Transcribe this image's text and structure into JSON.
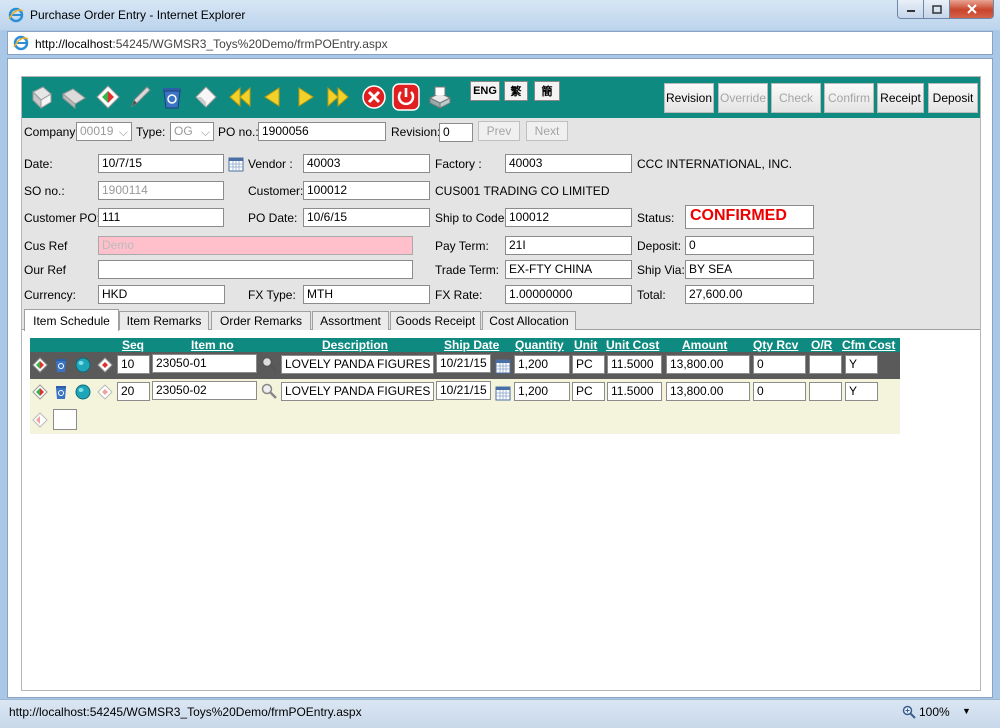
{
  "window": {
    "title": "Purchase Order Entry - Internet Explorer",
    "address_host": "http://localhost",
    "address_path": ":54245/WGMSR3_Toys%20Demo/frmPOEntry.aspx",
    "status_url": "http://localhost:54245/WGMSR3_Toys%20Demo/frmPOEntry.aspx",
    "zoom": "100%"
  },
  "toolbar": {
    "icons": [
      "new-icon",
      "copy-icon",
      "edit-diamond-icon",
      "pencil-icon",
      "recycle-bin-icon",
      "eraser-icon",
      "first-icon",
      "previous-icon",
      "next-icon",
      "last-icon",
      "cancel-icon",
      "power-icon",
      "print-icon"
    ],
    "lang_eng": "ENG",
    "lang_trad": "繁",
    "lang_simp": "簡",
    "revision": "Revision",
    "override": "Override",
    "check": "Check",
    "confirm": "Confirm",
    "receipt": "Receipt",
    "deposit": "Deposit"
  },
  "header": {
    "company_label": "Company",
    "company_value": "00019",
    "type_label": "Type:",
    "type_value": "OG",
    "po_label": "PO no.:",
    "po_value": "1900056",
    "revision_label": "Revision:",
    "revision_value": "0",
    "prev": "Prev",
    "next": "Next"
  },
  "form": {
    "date_label": "Date:",
    "date_value": "10/7/15",
    "vendor_label": "Vendor :",
    "vendor_value": "40003",
    "factory_label": "Factory :",
    "factory_value": "40003",
    "factory_name": "CCC INTERNATIONAL, INC.",
    "so_label": "SO no.:",
    "so_value": "1900114",
    "customer_label": "Customer:",
    "customer_value": "100012",
    "customer_name": "CUS001 TRADING CO LIMITED",
    "custpo_label": "Customer PO:",
    "custpo_value": "111",
    "podate_label": "PO Date:",
    "podate_value": "10/6/15",
    "shipto_label": "Ship to Code:",
    "shipto_value": "100012",
    "status_label": "Status:",
    "status_value": "CONFIRMED",
    "cusref_label": "Cus Ref",
    "cusref_value": "Demo",
    "payterm_label": "Pay Term:",
    "payterm_value": "21I",
    "deposit_label": "Deposit:",
    "deposit_value": "0",
    "ourref_label": "Our Ref",
    "ourref_value": "",
    "tradeterm_label": "Trade Term:",
    "tradeterm_value": "EX-FTY CHINA",
    "shipvia_label": "Ship Via:",
    "shipvia_value": "BY SEA",
    "currency_label": "Currency:",
    "currency_value": "HKD",
    "fxtype_label": "FX Type:",
    "fxtype_value": "MTH",
    "fxrate_label": "FX Rate:",
    "fxrate_value": "1.00000000",
    "total_label": "Total:",
    "total_value": "27,600.00"
  },
  "tabs": [
    "Item Schedule",
    "Item Remarks",
    "Order Remarks",
    "Assortment",
    "Goods Receipt",
    "Cost Allocation"
  ],
  "grid": {
    "columns": [
      "Seq",
      "Item no",
      "Description",
      "Ship Date",
      "Quantity",
      "Unit",
      "Unit Cost",
      "Amount",
      "Qty Rcv",
      "O/R",
      "Cfm Cost"
    ],
    "rows": [
      {
        "seq": "10",
        "item": "23050-01",
        "desc": "LOVELY PANDA FIGURES M",
        "ship": "10/21/15",
        "qty": "1,200",
        "unit": "PC",
        "cost": "11.5000",
        "amount": "13,800.00",
        "rcv": "0",
        "or": "",
        "cfm": "Y"
      },
      {
        "seq": "20",
        "item": "23050-02",
        "desc": "LOVELY PANDA FIGURES M",
        "ship": "10/21/15",
        "qty": "1,200",
        "unit": "PC",
        "cost": "11.5000",
        "amount": "13,800.00",
        "rcv": "0",
        "or": "",
        "cfm": "Y"
      }
    ],
    "new_seq": ""
  }
}
